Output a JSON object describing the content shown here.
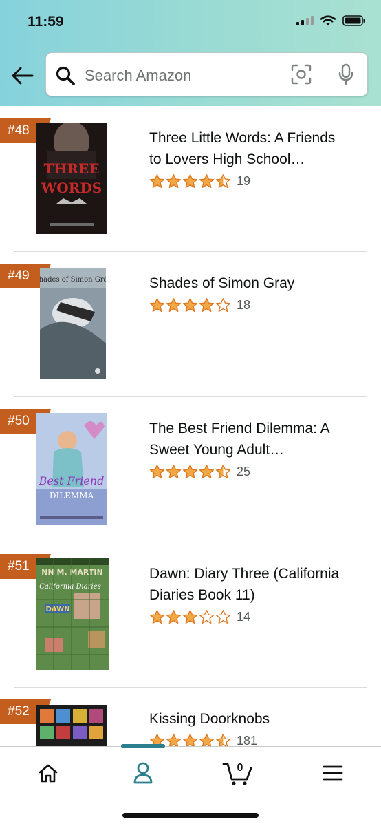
{
  "status_bar": {
    "time": "11:59"
  },
  "search": {
    "placeholder": "Search Amazon"
  },
  "items": [
    {
      "rank": "#48",
      "title_line1": "Three Little Words: A Friends",
      "title_line2": "to Lovers High School…",
      "rating": 4.5,
      "reviews": "19",
      "cover_text": "THREE WORDS"
    },
    {
      "rank": "#49",
      "title_line1": "Shades of Simon Gray",
      "title_line2": "",
      "rating": 4,
      "reviews": "18",
      "cover_text": "Shades of Simon Gray"
    },
    {
      "rank": "#50",
      "title_line1": "The Best Friend Dilemma: A",
      "title_line2": "Sweet Young Adult…",
      "rating": 4.5,
      "reviews": "25",
      "cover_text": "Best Friend"
    },
    {
      "rank": "#51",
      "title_line1": "Dawn: Diary Three (California",
      "title_line2": "Diaries Book 11)",
      "rating": 3,
      "reviews": "14",
      "cover_text": "DAWN"
    },
    {
      "rank": "#52",
      "title_line1": "Kissing Doorknobs",
      "title_line2": "",
      "rating": 4.5,
      "reviews": "181",
      "cover_text": ""
    }
  ],
  "tabbar": {
    "cart_count": "0",
    "active_tab": "account"
  },
  "colors": {
    "rank_badge": "#c45e1e",
    "star": "#f3a847",
    "accent": "#2b7f8f"
  }
}
